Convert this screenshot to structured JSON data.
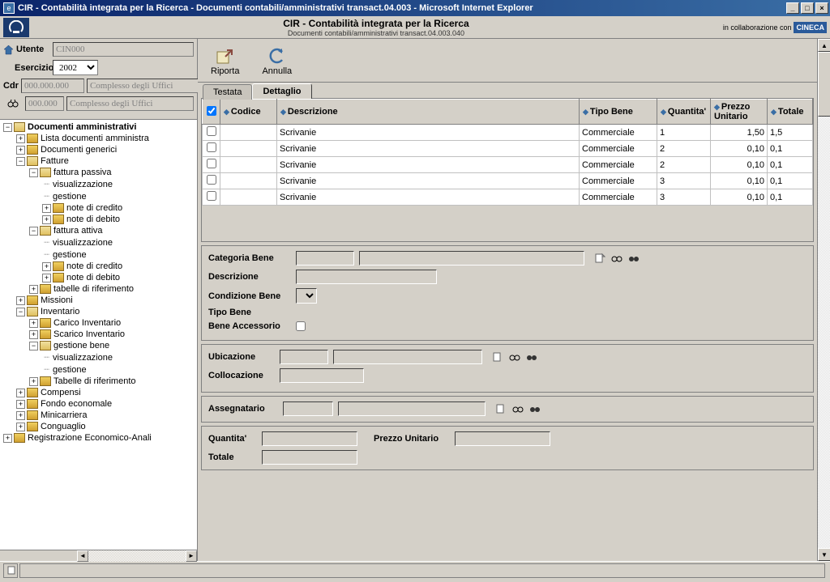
{
  "window": {
    "title": "CIR - Contabilità integrata per la Ricerca - Documenti contabili/amministrativi transact.04.003 - Microsoft Internet Explorer"
  },
  "header": {
    "app_title": "CIR - Contabilità integrata per la Ricerca",
    "subtitle": "Documenti contabili/amministrativi transact.04.003.040",
    "collab": "in collaborazione con",
    "brand": "CINECA"
  },
  "left_form": {
    "utente_label": "Utente",
    "utente_value": "CIN000",
    "esercizio_label": "Esercizio",
    "esercizio_value": "2002",
    "cdr_label": "Cdr",
    "cdr_code": "000.000.000",
    "cdr_desc": "Complesso degli Uffici",
    "filter_code": "000.000",
    "filter_desc": "Complesso degli Uffici"
  },
  "tree": [
    {
      "d": 0,
      "t": "-",
      "i": "open",
      "l": "Documenti amministrativi",
      "b": true
    },
    {
      "d": 1,
      "t": "+",
      "i": "closed",
      "l": "Lista documenti amministra"
    },
    {
      "d": 1,
      "t": "+",
      "i": "closed",
      "l": "Documenti generici"
    },
    {
      "d": 1,
      "t": "-",
      "i": "open",
      "l": "Fatture"
    },
    {
      "d": 2,
      "t": "-",
      "i": "open",
      "l": "fattura passiva"
    },
    {
      "d": 3,
      "t": "",
      "i": "",
      "l": "visualizzazione"
    },
    {
      "d": 3,
      "t": "",
      "i": "",
      "l": "gestione"
    },
    {
      "d": 3,
      "t": "+",
      "i": "closed",
      "l": "note di credito"
    },
    {
      "d": 3,
      "t": "+",
      "i": "closed",
      "l": "note di debito"
    },
    {
      "d": 2,
      "t": "-",
      "i": "open",
      "l": "fattura attiva"
    },
    {
      "d": 3,
      "t": "",
      "i": "",
      "l": "visualizzazione"
    },
    {
      "d": 3,
      "t": "",
      "i": "",
      "l": "gestione"
    },
    {
      "d": 3,
      "t": "+",
      "i": "closed",
      "l": "note di credito"
    },
    {
      "d": 3,
      "t": "+",
      "i": "closed",
      "l": "note di debito"
    },
    {
      "d": 2,
      "t": "+",
      "i": "closed",
      "l": "tabelle di riferimento"
    },
    {
      "d": 1,
      "t": "+",
      "i": "closed",
      "l": "Missioni"
    },
    {
      "d": 1,
      "t": "-",
      "i": "open",
      "l": "Inventario"
    },
    {
      "d": 2,
      "t": "+",
      "i": "closed",
      "l": "Carico Inventario"
    },
    {
      "d": 2,
      "t": "+",
      "i": "closed",
      "l": "Scarico Inventario"
    },
    {
      "d": 2,
      "t": "-",
      "i": "open",
      "l": "gestione bene"
    },
    {
      "d": 3,
      "t": "",
      "i": "",
      "l": "visualizzazione"
    },
    {
      "d": 3,
      "t": "",
      "i": "",
      "l": "gestione"
    },
    {
      "d": 2,
      "t": "+",
      "i": "closed",
      "l": "Tabelle di riferimento"
    },
    {
      "d": 1,
      "t": "+",
      "i": "closed",
      "l": "Compensi"
    },
    {
      "d": 1,
      "t": "+",
      "i": "closed",
      "l": "Fondo economale"
    },
    {
      "d": 1,
      "t": "+",
      "i": "closed",
      "l": "Minicarriera"
    },
    {
      "d": 1,
      "t": "+",
      "i": "closed",
      "l": "Conguaglio"
    },
    {
      "d": 0,
      "t": "+",
      "i": "closed",
      "l": "Registrazione Economico-Anali"
    }
  ],
  "toolbar": {
    "riporta": "Riporta",
    "annulla": "Annulla"
  },
  "tabs": {
    "testata": "Testata",
    "dettaglio": "Dettaglio"
  },
  "grid": {
    "cols": {
      "codice": "Codice",
      "descrizione": "Descrizione",
      "tipobene": "Tipo Bene",
      "quantita": "Quantita'",
      "prezzo": "Prezzo Unitario",
      "totale": "Totale"
    },
    "rows": [
      {
        "codice": "",
        "desc": "Scrivanie",
        "tipo": "Commerciale",
        "qta": "1",
        "prezzo": "1,50",
        "tot": "1,5"
      },
      {
        "codice": "",
        "desc": "Scrivanie",
        "tipo": "Commerciale",
        "qta": "2",
        "prezzo": "0,10",
        "tot": "0,1"
      },
      {
        "codice": "",
        "desc": "Scrivanie",
        "tipo": "Commerciale",
        "qta": "2",
        "prezzo": "0,10",
        "tot": "0,1"
      },
      {
        "codice": "",
        "desc": "Scrivanie",
        "tipo": "Commerciale",
        "qta": "3",
        "prezzo": "0,10",
        "tot": "0,1"
      },
      {
        "codice": "",
        "desc": "Scrivanie",
        "tipo": "Commerciale",
        "qta": "3",
        "prezzo": "0,10",
        "tot": "0,1"
      }
    ]
  },
  "detail": {
    "categoria_bene": "Categoria Bene",
    "descrizione": "Descrizione",
    "condizione_bene": "Condizione Bene",
    "tipo_bene": "Tipo Bene",
    "bene_accessorio": "Bene Accessorio",
    "ubicazione": "Ubicazione",
    "collocazione": "Collocazione",
    "assegnatario": "Assegnatario",
    "quantita": "Quantita'",
    "prezzo_unitario": "Prezzo Unitario",
    "totale": "Totale"
  }
}
